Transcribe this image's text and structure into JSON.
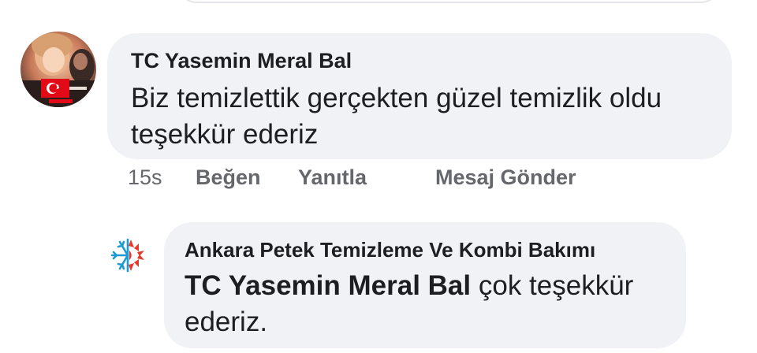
{
  "previous_comment": {},
  "comment": {
    "author": "TC Yasemin Meral Bal",
    "text": "Biz temizlettik gerçekten güzel temizlik oldu teşekkür ederiz",
    "avatar": "profile-photo-with-turkish-flag",
    "actions": {
      "time": "15s",
      "like": "Beğen",
      "reply": "Yanıtla",
      "message": "Mesaj Gönder"
    }
  },
  "reply": {
    "author": "Ankara Petek Temizleme Ve Kombi Bakımı",
    "mention": "TC Yasemin Meral Bal",
    "text": " çok teşekkür ederiz.",
    "avatar": "snowflake-sun-logo"
  },
  "colors": {
    "bubble_bg": "#f0f2f5",
    "text": "#1c1e21",
    "secondary": "#65676b",
    "flag_red": "#e30a17",
    "logo_red": "#e8392b",
    "logo_blue": "#1b9ad6"
  }
}
